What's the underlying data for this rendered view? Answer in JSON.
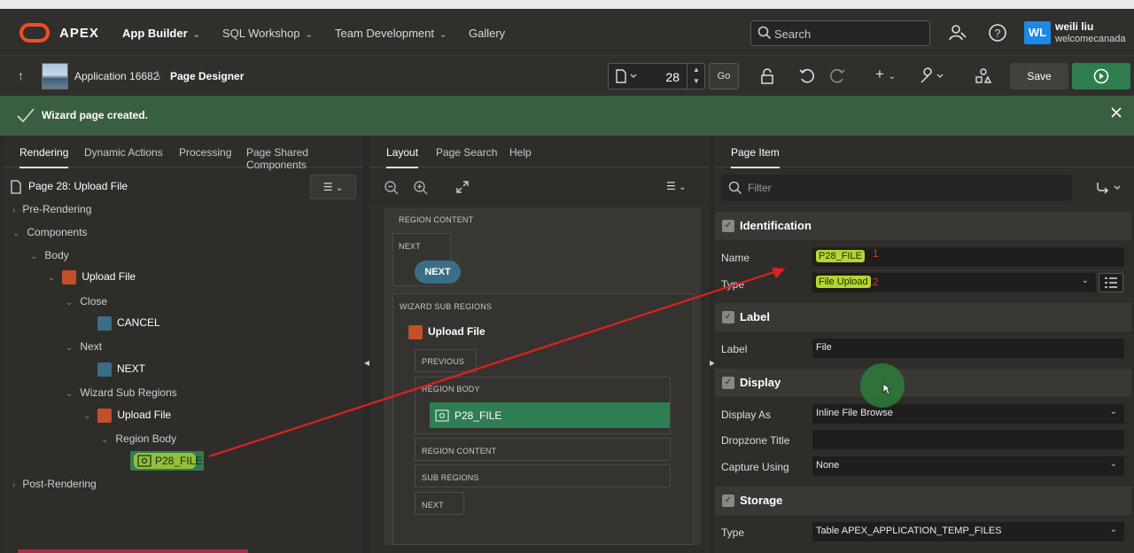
{
  "topnav": {
    "brand": "APEX",
    "items": [
      {
        "label": "App Builder",
        "active": true
      },
      {
        "label": "SQL Workshop"
      },
      {
        "label": "Team Development"
      },
      {
        "label": "Gallery"
      }
    ],
    "search_placeholder": "Search",
    "user": {
      "initials": "WL",
      "name": "weili liu",
      "workspace": "welcomecanada"
    }
  },
  "toolbar": {
    "app_label": "Application 16682",
    "page_label": "Page Designer",
    "page_number": "28",
    "go_label": "Go",
    "save_label": "Save"
  },
  "banner": {
    "message": "Wizard page created."
  },
  "left_panel": {
    "tabs": [
      "Rendering",
      "Dynamic Actions",
      "Processing",
      "Page Shared Components"
    ],
    "page_title": "Page 28: Upload File",
    "tree": {
      "pre_rendering": "Pre-Rendering",
      "components": "Components",
      "body": "Body",
      "upload_file": "Upload File",
      "close": "Close",
      "cancel": "CANCEL",
      "next_group": "Next",
      "next_btn": "NEXT",
      "wizard_sub_regions": "Wizard Sub Regions",
      "upload_file_sub": "Upload File",
      "region_body": "Region Body",
      "p28_file": "P28_FILE",
      "post_rendering": "Post-Rendering"
    }
  },
  "mid_panel": {
    "tabs": [
      "Layout",
      "Page Search",
      "Help"
    ],
    "canvas": {
      "region_content_top": "REGION CONTENT",
      "next_label": "NEXT",
      "next_button": "NEXT",
      "wizard_sub_regions": "WIZARD SUB REGIONS",
      "upload_file": "Upload File",
      "previous": "PREVIOUS",
      "region_body": "REGION BODY",
      "p28_file": "P28_FILE",
      "region_content": "REGION CONTENT",
      "sub_regions": "SUB REGIONS",
      "next_bottom": "NEXT"
    }
  },
  "right_panel": {
    "tab": "Page Item",
    "filter_placeholder": "Filter",
    "sections": {
      "identification": {
        "title": "Identification",
        "name_label": "Name",
        "name_value": "P28_FILE",
        "name_anno": "1",
        "type_label": "Type",
        "type_value": "File Upload",
        "type_anno": "2"
      },
      "label": {
        "title": "Label",
        "label_label": "Label",
        "label_value": "File"
      },
      "display": {
        "title": "Display",
        "display_as_label": "Display As",
        "display_as_value": "Inline File Browse",
        "dropzone_label": "Dropzone Title",
        "dropzone_value": "",
        "capture_label": "Capture Using",
        "capture_value": "None"
      },
      "storage": {
        "title": "Storage",
        "type_label": "Type",
        "type_value": "Table APEX_APPLICATION_TEMP_FILES"
      }
    }
  },
  "colors": {
    "accent_green": "#2f7d52",
    "highlight_yellow": "#b5d632",
    "annotation_red": "#e03030",
    "brand_orange": "#f04e23"
  }
}
